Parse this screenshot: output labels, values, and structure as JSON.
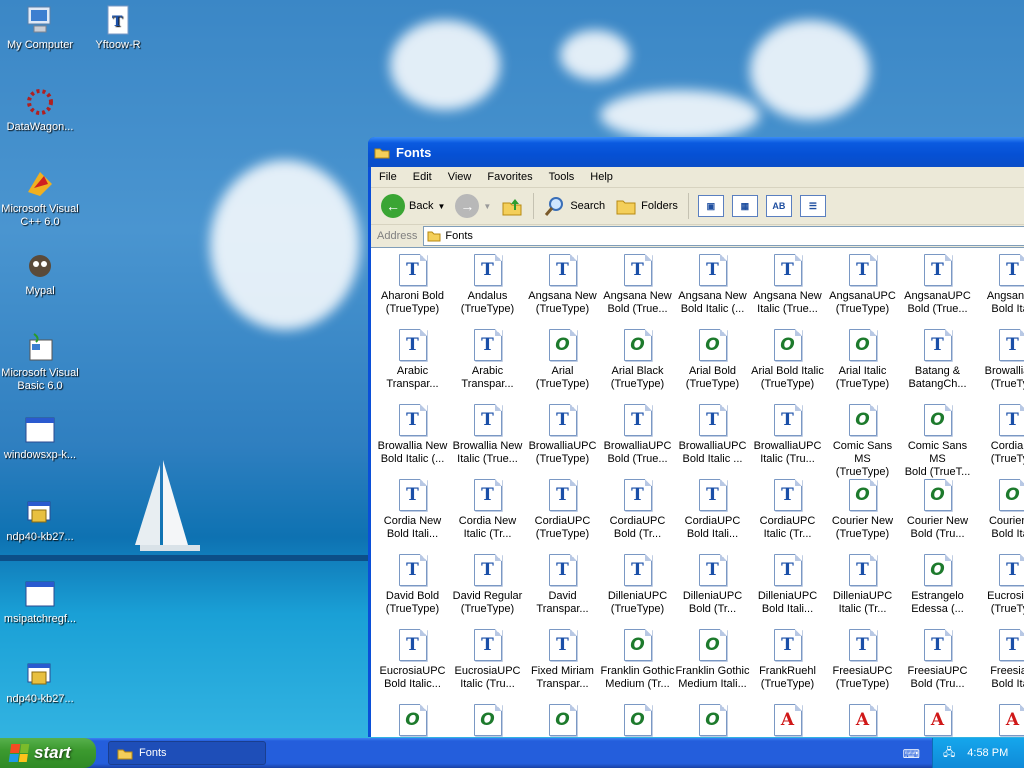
{
  "desktop": {
    "icons": [
      {
        "label": "My Computer",
        "icon": "my-computer-icon"
      },
      {
        "label": "Yftoow-R",
        "icon": "font-file-icon"
      },
      {
        "label": "DataWagon...",
        "icon": "datawagon-icon"
      },
      {
        "label": "Microsoft Visual C++ 6.0",
        "icon": "visual-cpp-icon"
      },
      {
        "label": "Mypal",
        "icon": "mypal-icon"
      },
      {
        "label": "Microsoft Visual Basic 6.0",
        "icon": "visual-basic-icon"
      },
      {
        "label": "windowsxp-k...",
        "icon": "window-app-icon"
      },
      {
        "label": "ndp40-kb27...",
        "icon": "installer-icon"
      },
      {
        "label": "msipatchregf...",
        "icon": "window-app-icon"
      },
      {
        "label": "ndp40-kb27...",
        "icon": "installer-icon"
      }
    ]
  },
  "window": {
    "title": "Fonts",
    "menu": [
      "File",
      "Edit",
      "View",
      "Favorites",
      "Tools",
      "Help"
    ],
    "toolbar": {
      "back": "Back",
      "search": "Search",
      "folders": "Folders"
    },
    "address_label": "Address",
    "address_value": "Fonts",
    "files": [
      {
        "l1": "Aharoni Bold",
        "l2": "(TrueType)",
        "g": "tt"
      },
      {
        "l1": "Andalus",
        "l2": "(TrueType)",
        "g": "tt"
      },
      {
        "l1": "Angsana New",
        "l2": "(TrueType)",
        "g": "tt"
      },
      {
        "l1": "Angsana New",
        "l2": "Bold (True...",
        "g": "tt"
      },
      {
        "l1": "Angsana New",
        "l2": "Bold Italic (...",
        "g": "tt"
      },
      {
        "l1": "Angsana New",
        "l2": "Italic (True...",
        "g": "tt"
      },
      {
        "l1": "AngsanaUPC",
        "l2": "(TrueType)",
        "g": "tt"
      },
      {
        "l1": "AngsanaUPC",
        "l2": "Bold (True...",
        "g": "tt"
      },
      {
        "l1": "AngsanaU",
        "l2": "Bold Itali",
        "g": "tt"
      },
      {
        "l1": "Arabic",
        "l2": "Transpar...",
        "g": "tt"
      },
      {
        "l1": "Arabic",
        "l2": "Transpar...",
        "g": "tt"
      },
      {
        "l1": "Arial",
        "l2": "(TrueType)",
        "g": "ot"
      },
      {
        "l1": "Arial Black",
        "l2": "(TrueType)",
        "g": "ot"
      },
      {
        "l1": "Arial Bold",
        "l2": "(TrueType)",
        "g": "ot"
      },
      {
        "l1": "Arial Bold Italic",
        "l2": "(TrueType)",
        "g": "ot"
      },
      {
        "l1": "Arial Italic",
        "l2": "(TrueType)",
        "g": "ot"
      },
      {
        "l1": "Batang &",
        "l2": "BatangCh...",
        "g": "tt"
      },
      {
        "l1": "Browallia N",
        "l2": "(TrueTyp",
        "g": "tt"
      },
      {
        "l1": "Browallia New",
        "l2": "Bold Italic (...",
        "g": "tt"
      },
      {
        "l1": "Browallia New",
        "l2": "Italic (True...",
        "g": "tt"
      },
      {
        "l1": "BrowalliaUPC",
        "l2": "(TrueType)",
        "g": "tt"
      },
      {
        "l1": "BrowalliaUPC",
        "l2": "Bold (True...",
        "g": "tt"
      },
      {
        "l1": "BrowalliaUPC",
        "l2": "Bold Italic ...",
        "g": "tt"
      },
      {
        "l1": "BrowalliaUPC",
        "l2": "Italic (Tru...",
        "g": "tt"
      },
      {
        "l1": "Comic Sans MS",
        "l2": "(TrueType)",
        "g": "ot"
      },
      {
        "l1": "Comic Sans MS",
        "l2": "Bold (TrueT...",
        "g": "ot"
      },
      {
        "l1": "Cordia N",
        "l2": "(TrueTyp",
        "g": "tt"
      },
      {
        "l1": "Cordia New",
        "l2": "Bold Itali...",
        "g": "tt"
      },
      {
        "l1": "Cordia New",
        "l2": "Italic (Tr...",
        "g": "tt"
      },
      {
        "l1": "CordiaUPC",
        "l2": "(TrueType)",
        "g": "tt"
      },
      {
        "l1": "CordiaUPC",
        "l2": "Bold (Tr...",
        "g": "tt"
      },
      {
        "l1": "CordiaUPC",
        "l2": "Bold Itali...",
        "g": "tt"
      },
      {
        "l1": "CordiaUPC",
        "l2": "Italic (Tr...",
        "g": "tt"
      },
      {
        "l1": "Courier New",
        "l2": "(TrueType)",
        "g": "ot"
      },
      {
        "l1": "Courier New",
        "l2": "Bold (Tru...",
        "g": "ot"
      },
      {
        "l1": "Courier N",
        "l2": "Bold Itali",
        "g": "ot"
      },
      {
        "l1": "David Bold",
        "l2": "(TrueType)",
        "g": "tt"
      },
      {
        "l1": "David Regular",
        "l2": "(TrueType)",
        "g": "tt"
      },
      {
        "l1": "David",
        "l2": "Transpar...",
        "g": "tt"
      },
      {
        "l1": "DilleniaUPC",
        "l2": "(TrueType)",
        "g": "tt"
      },
      {
        "l1": "DilleniaUPC",
        "l2": "Bold (Tr...",
        "g": "tt"
      },
      {
        "l1": "DilleniaUPC",
        "l2": "Bold Itali...",
        "g": "tt"
      },
      {
        "l1": "DilleniaUPC",
        "l2": "Italic (Tr...",
        "g": "tt"
      },
      {
        "l1": "Estrangelo",
        "l2": "Edessa (...",
        "g": "ot"
      },
      {
        "l1": "EucrosiaU",
        "l2": "(TrueTyp",
        "g": "tt"
      },
      {
        "l1": "EucrosiaUPC",
        "l2": "Bold Italic...",
        "g": "tt"
      },
      {
        "l1": "EucrosiaUPC",
        "l2": "Italic (Tru...",
        "g": "tt"
      },
      {
        "l1": "Fixed Miriam",
        "l2": "Transpar...",
        "g": "tt"
      },
      {
        "l1": "Franklin Gothic",
        "l2": "Medium (Tr...",
        "g": "ot"
      },
      {
        "l1": "Franklin Gothic",
        "l2": "Medium Itali...",
        "g": "ot"
      },
      {
        "l1": "FrankRuehl",
        "l2": "(TrueType)",
        "g": "tt"
      },
      {
        "l1": "FreesiaUPC",
        "l2": "(TrueType)",
        "g": "tt"
      },
      {
        "l1": "FreesiaUPC",
        "l2": "Bold (Tru...",
        "g": "tt"
      },
      {
        "l1": "FreesiaU",
        "l2": "Bold Itali",
        "g": "tt"
      },
      {
        "l1": "",
        "l2": "",
        "g": "ot"
      },
      {
        "l1": "",
        "l2": "",
        "g": "ot"
      },
      {
        "l1": "",
        "l2": "",
        "g": "ot"
      },
      {
        "l1": "",
        "l2": "",
        "g": "ot"
      },
      {
        "l1": "",
        "l2": "",
        "g": "ot"
      },
      {
        "l1": "",
        "l2": "",
        "g": "ra"
      },
      {
        "l1": "",
        "l2": "",
        "g": "ra"
      },
      {
        "l1": "",
        "l2": "",
        "g": "ra"
      },
      {
        "l1": "",
        "l2": "",
        "g": "ra"
      }
    ]
  },
  "taskbar": {
    "start_label": "start",
    "task_button": "Fonts",
    "clock": "4:58 PM"
  }
}
